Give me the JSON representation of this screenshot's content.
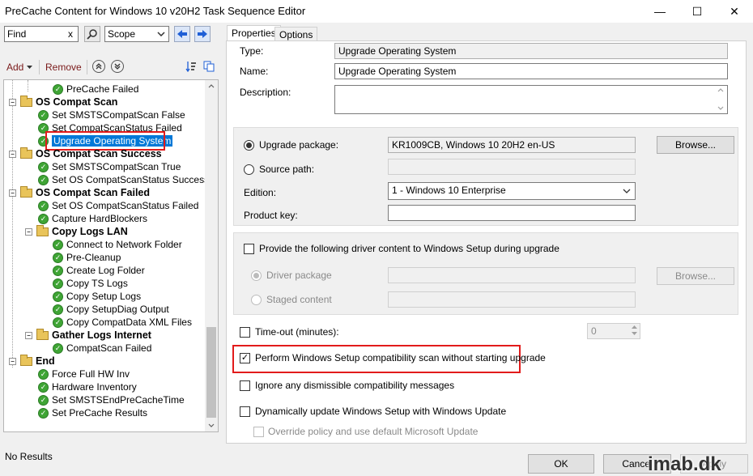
{
  "window": {
    "title": "PreCache Content for Windows 10 v20H2 Task Sequence Editor",
    "minimize": "—",
    "maximize": "☐",
    "close": "✕"
  },
  "toolbar": {
    "find_value": "Find",
    "find_clear": "x",
    "scope_value": "Scope",
    "add_label": "Add",
    "remove_label": "Remove"
  },
  "tree": {
    "items": [
      {
        "label": "PreCache Failed",
        "type": "step"
      },
      {
        "label": "OS Compat Scan",
        "type": "group"
      },
      {
        "label": "Set SMSTSCompatScan False",
        "type": "step"
      },
      {
        "label": "Set CompatScanStatus Failed",
        "type": "step"
      },
      {
        "label": "Upgrade Operating System",
        "type": "step"
      },
      {
        "label": "OS Compat Scan Success",
        "type": "group"
      },
      {
        "label": "Set SMSTSCompatScan True",
        "type": "step"
      },
      {
        "label": "Set OS CompatScanStatus Success",
        "type": "step"
      },
      {
        "label": "OS Compat Scan Failed",
        "type": "group"
      },
      {
        "label": "Set OS CompatScanStatus Failed",
        "type": "step"
      },
      {
        "label": "Capture HardBlockers",
        "type": "step"
      },
      {
        "label": "Copy Logs LAN",
        "type": "group"
      },
      {
        "label": "Connect to Network Folder",
        "type": "step"
      },
      {
        "label": "Pre-Cleanup",
        "type": "step"
      },
      {
        "label": "Create Log Folder",
        "type": "step"
      },
      {
        "label": "Copy TS Logs",
        "type": "step"
      },
      {
        "label": "Copy Setup Logs",
        "type": "step"
      },
      {
        "label": "Copy SetupDiag Output",
        "type": "step"
      },
      {
        "label": "Copy CompatData XML Files",
        "type": "step"
      },
      {
        "label": "Gather Logs Internet",
        "type": "group"
      },
      {
        "label": "CompatScan Failed",
        "type": "step"
      },
      {
        "label": "End",
        "type": "group"
      },
      {
        "label": "Force Full HW Inv",
        "type": "step"
      },
      {
        "label": "Hardware Inventory",
        "type": "step"
      },
      {
        "label": "Set SMSTSEndPreCacheTime",
        "type": "step"
      },
      {
        "label": "Set PreCache Results",
        "type": "step"
      }
    ]
  },
  "status": {
    "text": "No Results"
  },
  "tabs": [
    {
      "label": "Properties",
      "active": true
    },
    {
      "label": "Options",
      "active": false
    }
  ],
  "properties": {
    "type_label": "Type:",
    "type_value": "Upgrade Operating System",
    "name_label": "Name:",
    "name_value": "Upgrade Operating System",
    "description_label": "Description:",
    "description_value": "",
    "upgrade_package_label": "Upgrade package:",
    "upgrade_package_value": "KR1009CB, Windows 10 20H2  en-US",
    "browse_label": "Browse...",
    "source_path_label": "Source path:",
    "source_path_value": "",
    "edition_label": "Edition:",
    "edition_value": "1 - Windows 10 Enterprise",
    "product_key_label": "Product key:",
    "product_key_value": "",
    "driver_content_label": "Provide the following driver content to Windows Setup during upgrade",
    "driver_package_label": "Driver package",
    "driver_package_value": "",
    "driver_browse_label": "Browse...",
    "staged_content_label": "Staged content",
    "staged_content_value": "",
    "timeout_label": "Time-out (minutes):",
    "timeout_value": "0",
    "compat_scan_label": "Perform Windows Setup compatibility scan without starting upgrade",
    "ignore_label": "Ignore any dismissible compatibility messages",
    "dynamic_update_label": "Dynamically update Windows Setup with Windows Update",
    "override_label": "Override policy and use default Microsoft Update"
  },
  "footer": {
    "ok_label": "OK",
    "cancel_label": "Cancel",
    "apply_label": "Apply",
    "watermark": "imab.dk"
  }
}
